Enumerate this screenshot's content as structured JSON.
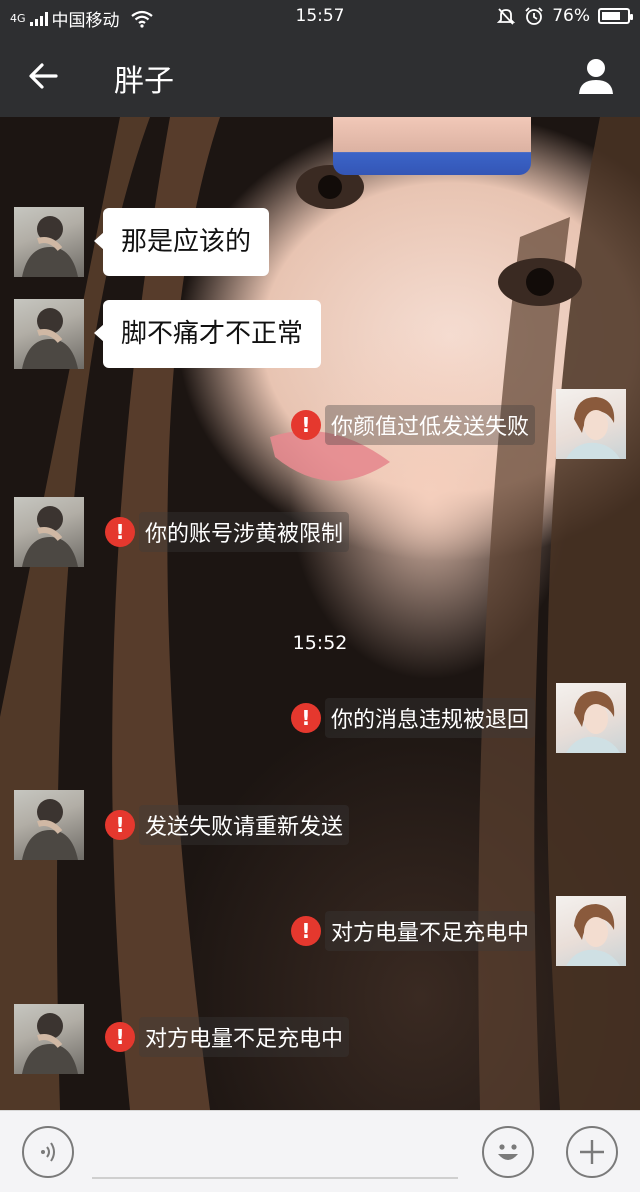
{
  "status_bar": {
    "network": "4G",
    "carrier": "中国移动",
    "time": "15:57",
    "battery": "76%",
    "battery_level": 0.76,
    "icons": [
      "signal-icon",
      "wifi-icon",
      "mute-icon",
      "alarm-icon",
      "battery-icon"
    ]
  },
  "header": {
    "title": "胖子",
    "back_icon": "arrow-left-icon",
    "profile_icon": "person-icon"
  },
  "messages": [
    {
      "side": "left",
      "type": "text",
      "text": "那是应该的"
    },
    {
      "side": "left",
      "type": "text",
      "text": "脚不痛才不正常"
    },
    {
      "side": "right",
      "type": "error",
      "text": "你颜值过低发送失败"
    },
    {
      "side": "left",
      "type": "error",
      "text": "你的账号涉黄被限制"
    },
    {
      "type": "time",
      "text": "15:52"
    },
    {
      "side": "right",
      "type": "error",
      "text": "你的消息违规被退回"
    },
    {
      "side": "left",
      "type": "error",
      "text": "发送失败请重新发送"
    },
    {
      "side": "right",
      "type": "error",
      "text": "对方电量不足充电中"
    },
    {
      "side": "left",
      "type": "error",
      "text": "对方电量不足充电中"
    }
  ],
  "error_badge": "!",
  "input_bar": {
    "voice_icon": "voice-icon",
    "emoji_icon": "emoji-icon",
    "plus_icon": "plus-icon"
  },
  "colors": {
    "bar": "#2e2f31",
    "error_red": "#e5382e",
    "bubble": "#ffffff",
    "input_bg": "#f4f4f6"
  }
}
